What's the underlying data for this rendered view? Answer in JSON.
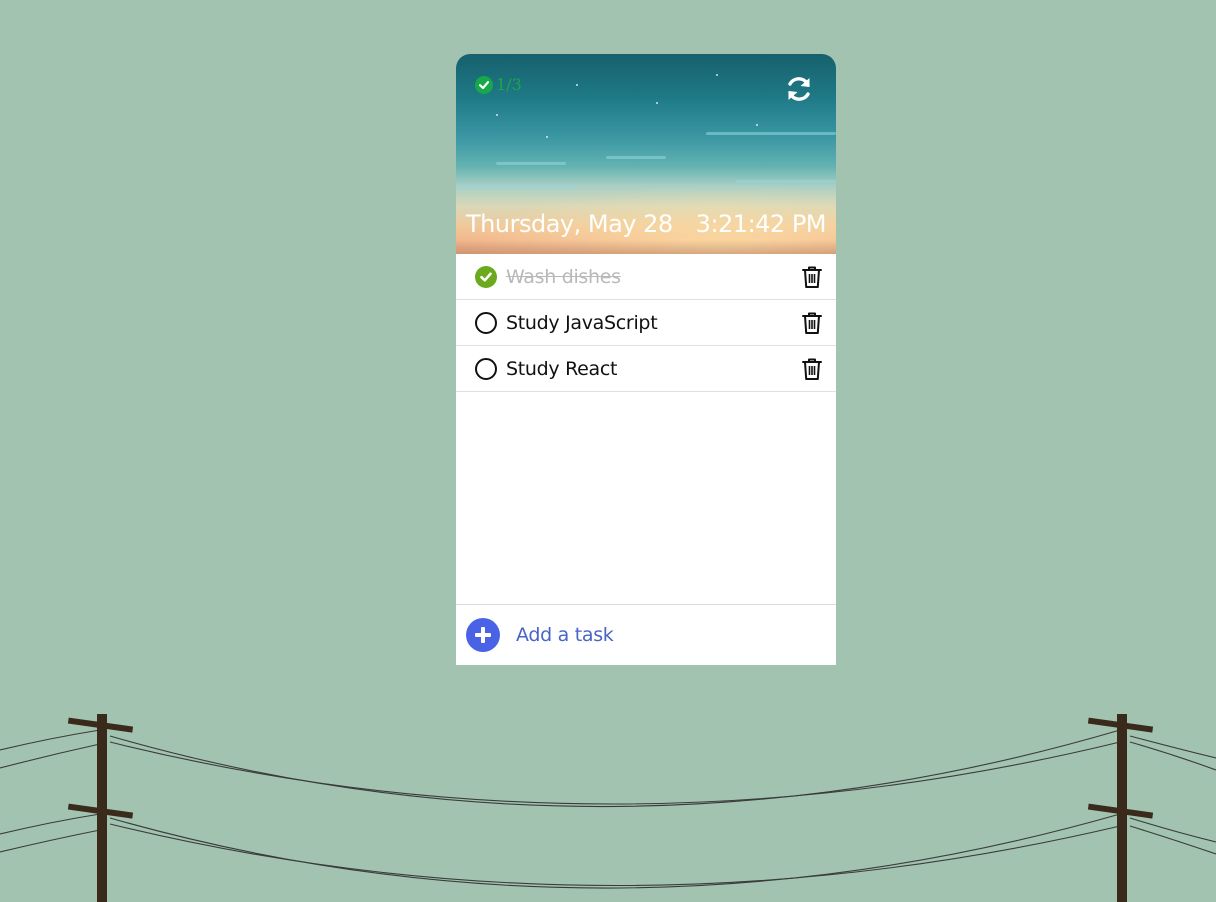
{
  "header": {
    "counter": "1/3",
    "date": "Thursday, May 28",
    "time": "3:21:42 PM"
  },
  "tasks": [
    {
      "label": "Wash dishes",
      "done": true
    },
    {
      "label": "Study JavaScript",
      "done": false
    },
    {
      "label": "Study React",
      "done": false
    }
  ],
  "add_task": {
    "label": "Add a task"
  },
  "icons": {
    "counter": "check-circle-icon",
    "refresh": "refresh-icon",
    "task_done": "check-circle-icon",
    "task_open": "empty-circle-icon",
    "delete": "trash-icon",
    "add": "plus-circle-icon"
  },
  "colors": {
    "background": "#a1c3af",
    "done_green": "#6aaa1c",
    "counter_green": "#1aa84a",
    "accent_blue": "#4a63e6",
    "done_text": "#b9b9b9"
  }
}
